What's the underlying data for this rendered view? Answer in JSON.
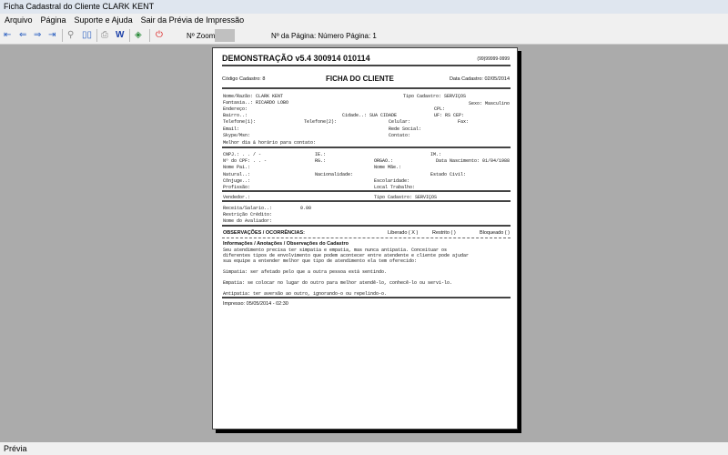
{
  "window": {
    "title": "Ficha Cadastral do Cliente CLARK KENT"
  },
  "menu": [
    "Arquivo",
    "Página",
    "Suporte e Ajuda",
    "Sair da Prévia de Impressão"
  ],
  "toolbar": {
    "zoom_label": "Nº Zoom",
    "page_label": "Nº da Página: Número Página: 1"
  },
  "status": "Prévia",
  "report": {
    "title": "DEMONSTRAÇÃO v5.4 300914 010114",
    "phone": "(99)99999-9999",
    "codigo": "Código Cadastro:    8",
    "heading": "FICHA DO CLIENTE",
    "data_cadastro": "Data Cadastro: 02/05/2014",
    "f": {
      "nome": "Nome/Razão: CLARK KENT",
      "tipo1": "Tipo Cadastro: SERVIÇOS",
      "fantasia": "Fantasia..: RICARDO LOBO",
      "sexo": "Sexo: Masculino",
      "endereco": "Endereço:",
      "cpl": "CPL:",
      "bairro": "Bairro..:",
      "cidade": "Cidade..: SUA CIDADE",
      "uf": "UF: RS CEP:",
      "tel1": "Telefone(1):",
      "tel2": "Telefone(2):",
      "celular": "Celular:",
      "fax": "Fax:",
      "email": "Email:",
      "rede": "Rede Social:",
      "skype": "Skype/Msn:",
      "contato": "Contato:",
      "melhor": "Melhor dia & horário para contato:",
      "cnpj": "CNPJ.:    .   .   /    -",
      "ie": "IE.:",
      "im": "IM.:",
      "cpf": "Nº do CPF:    .   .   -",
      "rg": "RG.:",
      "orgao": "ORGAO.:",
      "nasc": "Data Nascimento: 01/04/1988",
      "pai": "Nome Pai.:",
      "mae": "Nome Mãe.:",
      "natural": "Natural..:",
      "nacionalidade": "Nacionalidade:",
      "civil": "Estado Civil:",
      "conjuge": "Cônjuge..:",
      "escolaridade": "Escolaridade:",
      "profissao": "Profissão:",
      "local": "Local Trabalho:",
      "vendedor": "Vendedor.:",
      "tipo2": "Tipo Cadastro: SERVIÇOS",
      "receita": "Receita/Salario..:",
      "receita_val": "0.00",
      "restricao": "Restrição Crédito:",
      "avaliador": "Nome do Avaliador:"
    },
    "obs_title": "OBSERVAÇÕES / OCORRÊNCIAS:",
    "liberado": "Liberado ( X )",
    "restrito": "Restrito (  )",
    "bloqueado": "Bloqueado (  )",
    "info_title": "Informações / Anotações / Observações do Cadastro",
    "info": [
      "Seu atendimento precisa ter simpatia e empatia, mas nunca antipatia. Conceituar os",
      "diferentes tipos de envolvimento que podem acontecer entre atendente e cliente pode ajudar",
      "sua equipe a entender melhor que tipo de atendimento ela tem oferecido:"
    ],
    "simpatia": "Simpatia: ser afetado pelo que a outra pessoa está sentindo.",
    "empatia": "Empatia: se colocar no lugar do outro para melhor atendê-lo, conhecê-lo ou servi-lo.",
    "antipatia": "Antipatia: ter aversão ao outro, ignorando-o ou repelindo-o.",
    "impresso": "Impresso: 05/05/2014 - 02:30"
  }
}
